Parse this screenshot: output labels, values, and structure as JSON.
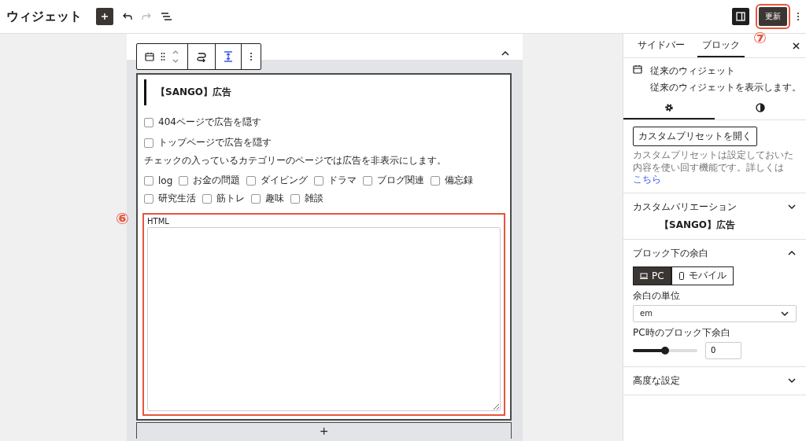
{
  "topbar": {
    "title": "ウィジェット",
    "update_button": "更新",
    "annotation": "⑦"
  },
  "editor": {
    "block_title": "【SANGO】広告",
    "options": [
      {
        "label": "404ページで広告を隠す",
        "checked": false
      },
      {
        "label": "トップページで広告を隠す",
        "checked": false
      }
    ],
    "category_note": "チェックの入っているカテゴリーのページでは広告を非表示にします。",
    "categories": [
      {
        "label": "log",
        "checked": false
      },
      {
        "label": "お金の問題",
        "checked": false
      },
      {
        "label": "ダイビング",
        "checked": false
      },
      {
        "label": "ドラマ",
        "checked": false
      },
      {
        "label": "ブログ関連",
        "checked": false
      },
      {
        "label": "備忘録",
        "checked": false
      },
      {
        "label": "研究生活",
        "checked": false
      },
      {
        "label": "筋トレ",
        "checked": false
      },
      {
        "label": "趣味",
        "checked": false
      },
      {
        "label": "雑談",
        "checked": false
      }
    ],
    "html_label": "HTML",
    "annotation": "⑥",
    "appender": "+"
  },
  "sidebar": {
    "tabs": [
      {
        "label": "サイドバー",
        "selected": false
      },
      {
        "label": "ブロック",
        "selected": true
      }
    ],
    "block": {
      "name": "従来のウィジェット",
      "description": "従来のウィジェットを表示します。"
    },
    "inspector_tabs": [
      {
        "kind": "settings",
        "selected": true
      },
      {
        "kind": "styles",
        "selected": false
      }
    ],
    "preset_button": "カスタムプリセットを開く",
    "preset_help": "カスタムプリセットは設定しておいた内容を使い回す機能です。詳しくは",
    "preset_link": "こちら",
    "panels": [
      {
        "kind": "variation",
        "title": "カスタムバリエーション",
        "expanded": false,
        "value": "【SANGO】広告"
      },
      {
        "kind": "spacing",
        "title": "ブロック下の余白",
        "expanded": true,
        "devices": [
          {
            "label": "PC",
            "selected": true
          },
          {
            "label": "モバイル",
            "selected": false
          }
        ],
        "unit_label": "余白の単位",
        "unit": "em",
        "slider_label": "PC時のブロック下余白",
        "level": 0.5,
        "value": "0"
      },
      {
        "kind": "advanced",
        "title": "高度な設定",
        "expanded": false
      }
    ]
  }
}
